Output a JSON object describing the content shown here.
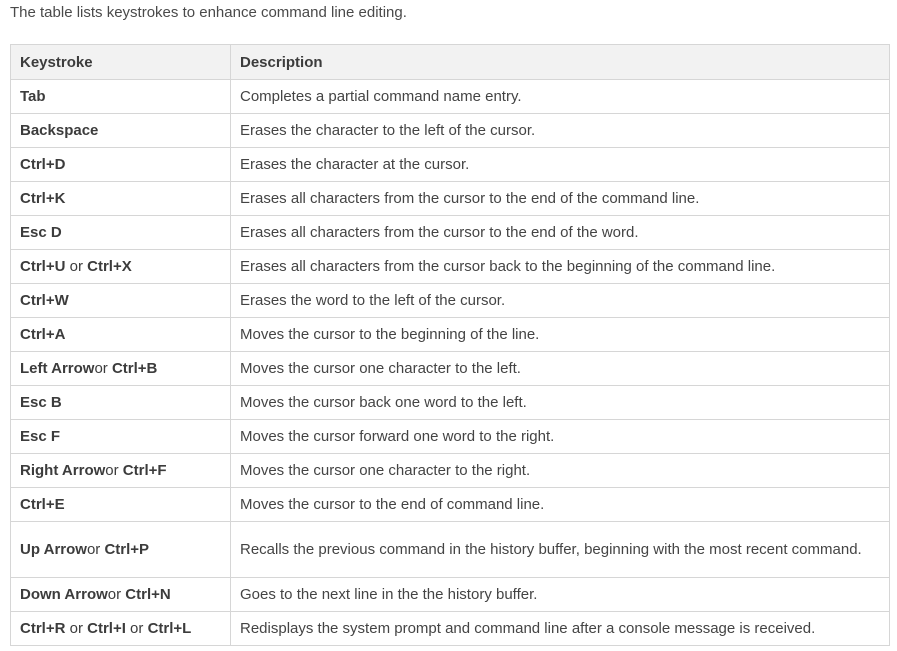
{
  "intro": "The table lists keystrokes to enhance command line editing.",
  "headers": {
    "keystroke": "Keystroke",
    "description": "Description"
  },
  "rows": [
    {
      "keys": [
        {
          "t": "Tab",
          "b": true
        }
      ],
      "desc": "Completes a partial command name entry."
    },
    {
      "keys": [
        {
          "t": "Backspace",
          "b": true
        }
      ],
      "desc": "Erases the character to the left of the cursor."
    },
    {
      "keys": [
        {
          "t": "Ctrl+D",
          "b": true
        }
      ],
      "desc": "Erases the character at the cursor."
    },
    {
      "keys": [
        {
          "t": "Ctrl+K",
          "b": true
        }
      ],
      "desc": "Erases all characters from the cursor to the end of the command line."
    },
    {
      "keys": [
        {
          "t": "Esc D",
          "b": true
        }
      ],
      "desc": "Erases all characters from the cursor to the end of the word."
    },
    {
      "keys": [
        {
          "t": "Ctrl+U",
          "b": true
        },
        {
          "t": " or ",
          "b": false
        },
        {
          "t": "Ctrl+X",
          "b": true
        }
      ],
      "desc": "Erases all characters from the cursor back to the beginning of the command line."
    },
    {
      "keys": [
        {
          "t": "Ctrl+W",
          "b": true
        }
      ],
      "desc": "Erases the word to the left of the cursor."
    },
    {
      "keys": [
        {
          "t": "Ctrl+A",
          "b": true
        }
      ],
      "desc": "Moves the cursor to the beginning of the line."
    },
    {
      "keys": [
        {
          "t": "Left Arrow",
          "b": true
        },
        {
          "t": "or ",
          "b": false
        },
        {
          "t": "Ctrl+B",
          "b": true
        }
      ],
      "desc": "Moves the cursor one character to the left."
    },
    {
      "keys": [
        {
          "t": "Esc B",
          "b": true
        }
      ],
      "desc": "Moves the cursor back one word to the left."
    },
    {
      "keys": [
        {
          "t": "Esc F",
          "b": true
        }
      ],
      "desc": "Moves the cursor forward one word to the right."
    },
    {
      "keys": [
        {
          "t": "Right Arrow",
          "b": true
        },
        {
          "t": "or ",
          "b": false
        },
        {
          "t": "Ctrl+F",
          "b": true
        }
      ],
      "desc": "Moves the cursor one character to the right."
    },
    {
      "keys": [
        {
          "t": "Ctrl+E",
          "b": true
        }
      ],
      "desc": "Moves the cursor to the end of command line."
    },
    {
      "keys": [
        {
          "t": "Up Arrow",
          "b": true
        },
        {
          "t": "or ",
          "b": false
        },
        {
          "t": "Ctrl+P",
          "b": true
        }
      ],
      "desc": "Recalls the previous command in the history buffer, beginning with the most recent command.",
      "tall": true
    },
    {
      "keys": [
        {
          "t": "Down Arrow",
          "b": true
        },
        {
          "t": "or ",
          "b": false
        },
        {
          "t": "Ctrl+N",
          "b": true
        }
      ],
      "desc": "Goes to the next line in the the history buffer."
    },
    {
      "keys": [
        {
          "t": "Ctrl+R",
          "b": true
        },
        {
          "t": " or ",
          "b": false
        },
        {
          "t": "Ctrl+I",
          "b": true
        },
        {
          "t": " or ",
          "b": false
        },
        {
          "t": "Ctrl+L",
          "b": true
        }
      ],
      "desc": "Redisplays the system prompt and command line after a console message is received."
    }
  ]
}
